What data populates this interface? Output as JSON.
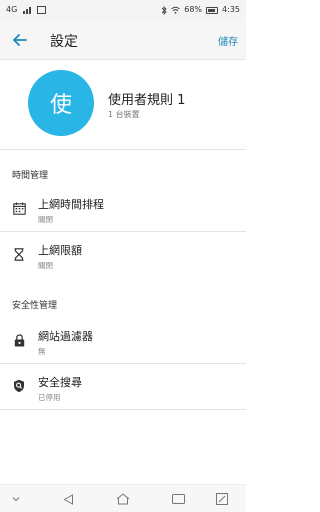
{
  "status_bar": {
    "left_text": "4G",
    "right_text": "68%",
    "time": "4:35"
  },
  "header": {
    "title": "設定",
    "save_label": "儲存"
  },
  "profile": {
    "avatar_char": "使",
    "avatar_color": "#29b6e6",
    "name": "使用者規則 1",
    "device_count": "1 台裝置"
  },
  "time_section": {
    "title": "時間管理",
    "items": [
      {
        "label": "上網時間排程",
        "status": "關閉",
        "icon": "calendar-icon"
      },
      {
        "label": "上網限額",
        "status": "關閉",
        "icon": "hourglass-icon"
      }
    ]
  },
  "security_section": {
    "title": "安全性管理",
    "items": [
      {
        "label": "網站過濾器",
        "status": "無",
        "icon": "lock-icon"
      },
      {
        "label": "安全搜尋",
        "status": "已停用",
        "icon": "shield-icon"
      }
    ]
  },
  "colors": {
    "accent": "#1e88b6",
    "avatar": "#29b6e6"
  }
}
